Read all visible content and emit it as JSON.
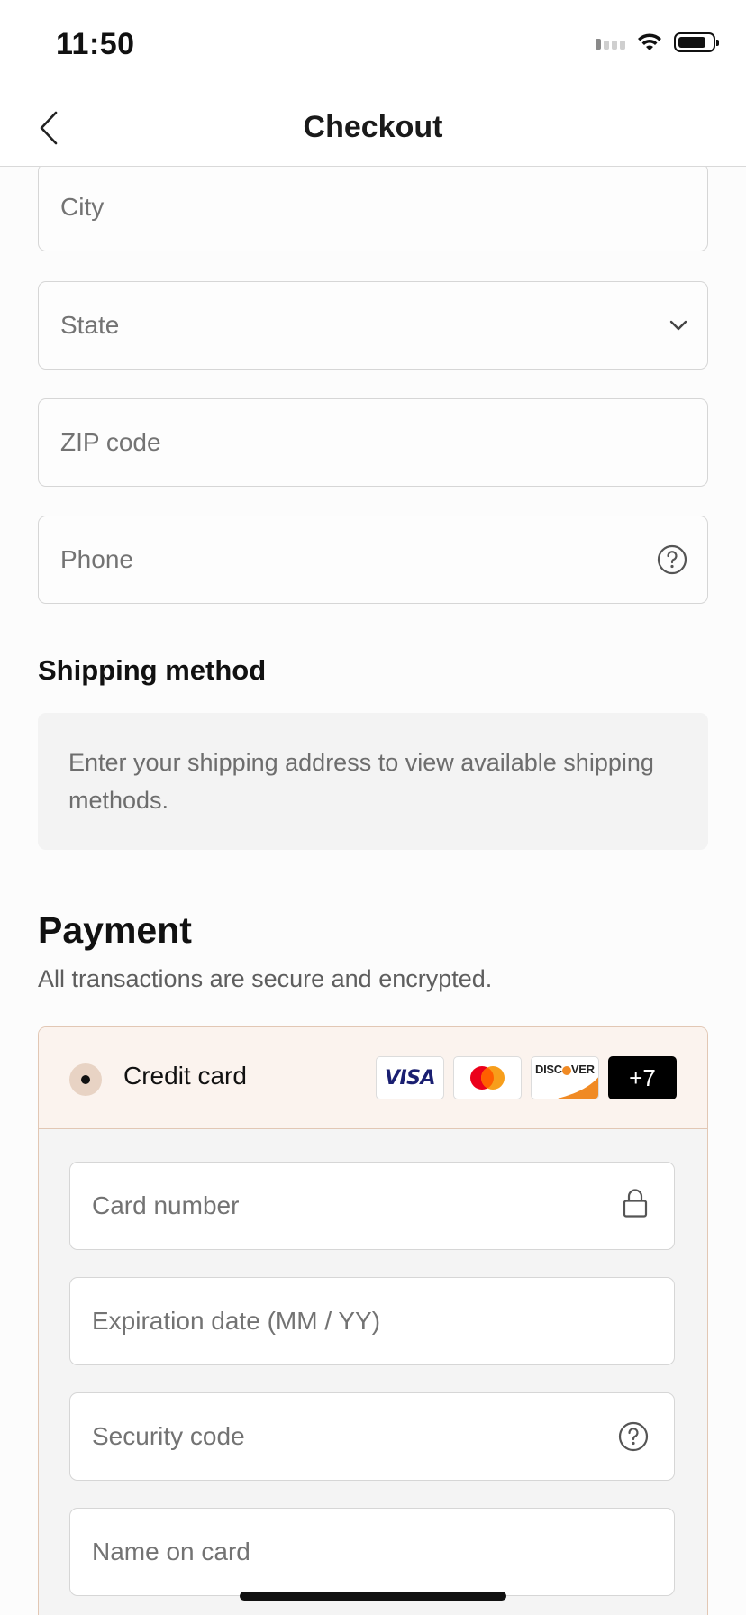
{
  "status_bar": {
    "time": "11:50"
  },
  "nav": {
    "title": "Checkout",
    "back_icon": "chevron-left-icon"
  },
  "address": {
    "city_placeholder": "City",
    "state_placeholder": "State",
    "zip_placeholder": "ZIP code",
    "phone_placeholder": "Phone"
  },
  "shipping": {
    "heading": "Shipping method",
    "notice": "Enter your shipping address to view available shipping methods."
  },
  "payment": {
    "heading": "Payment",
    "subtitle": "All transactions are secure and encrypted.",
    "method_label": "Credit card",
    "card_brands": [
      "VISA",
      "Mastercard",
      "DISCOVER"
    ],
    "more_brands": "+7",
    "visa_label": "VISA",
    "discover_label": "DISC",
    "discover_suffix": "VER",
    "card_number_placeholder": "Card number",
    "expiration_placeholder": "Expiration date (MM / YY)",
    "security_code_placeholder": "Security code",
    "name_on_card_placeholder": "Name on card",
    "selected_border_color": "#e2c7b4",
    "selected_bg_color": "#fbf3ee"
  }
}
